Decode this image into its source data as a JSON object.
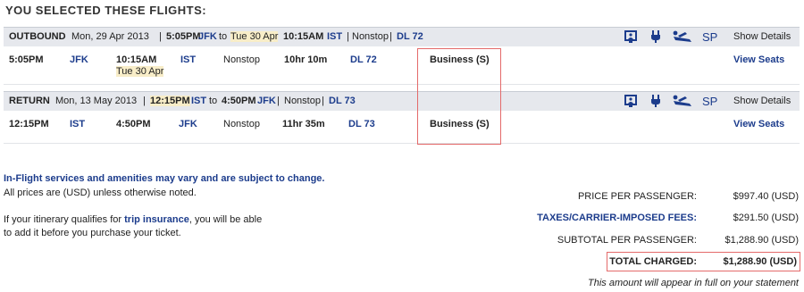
{
  "title": "YOU SELECTED THESE FLIGHTS:",
  "outbound": {
    "label": "OUTBOUND",
    "date": "Mon, 29 Apr 2013",
    "sep1": "|",
    "dep_time": "5:05PM",
    "dep_airport": "JFK",
    "to": "to",
    "arr_date": "Tue 30 Apr",
    "arr_time": "10:15AM",
    "arr_airport": "IST",
    "sep2": "|",
    "stops": "Nonstop",
    "sep3": "|",
    "flight": "DL 72",
    "show_details": "Show Details",
    "sp": "SP",
    "row": {
      "dep_time": "5:05PM",
      "dep_airport": "JFK",
      "arr_time": "10:15AM",
      "arr_date": "Tue 30 Apr",
      "arr_airport": "IST",
      "stops": "Nonstop",
      "duration": "10hr 10m",
      "flight": "DL 72",
      "cabin": "Business (S)",
      "view_seats": "View Seats"
    }
  },
  "return": {
    "label": "RETURN",
    "date": "Mon, 13 May 2013",
    "sep1": "|",
    "dep_time": "12:15PM",
    "dep_airport": "IST",
    "to": "to",
    "arr_time": "4:50PM",
    "arr_airport": "JFK",
    "sep2": "|",
    "stops": "Nonstop",
    "sep3": "|",
    "flight": "DL 73",
    "show_details": "Show Details",
    "sp": "SP",
    "row": {
      "dep_time": "12:15PM",
      "dep_airport": "IST",
      "arr_time": "4:50PM",
      "arr_airport": "JFK",
      "stops": "Nonstop",
      "duration": "11hr 35m",
      "flight": "DL 73",
      "cabin": "Business (S)",
      "view_seats": "View Seats"
    }
  },
  "notes": {
    "inflight": "In-Flight services and amenities may vary and are subject to change.",
    "prices": "All prices are (USD) unless otherwise noted.",
    "insurance_pre": "If your itinerary qualifies for ",
    "insurance_link": "trip insurance",
    "insurance_post": ", you will be able",
    "insurance_line2": "to add it before you purchase your ticket."
  },
  "pricing": {
    "price_per_passenger_label": "PRICE PER PASSENGER:",
    "price_per_passenger": "$997.40 (USD)",
    "taxes_label": "TAXES/CARRIER-IMPOSED FEES:",
    "taxes": "$291.50 (USD)",
    "subtotal_label": "SUBTOTAL PER PASSENGER:",
    "subtotal": "$1,288.90 (USD)",
    "total_label": "TOTAL CHARGED:",
    "total": "$1,288.90 (USD)",
    "statement_note": "This amount will appear in full on your statement"
  },
  "icons": [
    "personal-tv-icon",
    "power-outlet-icon",
    "flat-bed-seat-icon"
  ],
  "colors": {
    "link": "#1c3c8c",
    "header_bg": "#e6e8ed",
    "highlight": "#f8edc8",
    "callout": "#e46a6a"
  }
}
